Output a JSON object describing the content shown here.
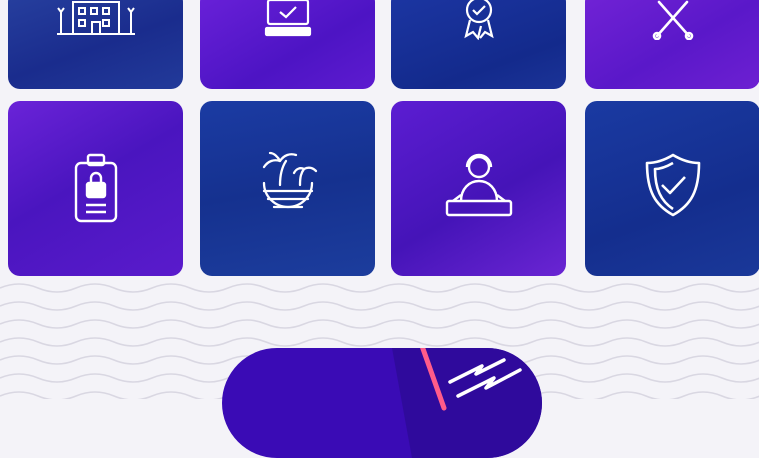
{
  "tiles": [
    {
      "id": "hotel",
      "icon": "hotel-building-icon",
      "tint": "#1b2f9a"
    },
    {
      "id": "checkin",
      "icon": "laptop-check-icon",
      "tint": "#5a1ad6"
    },
    {
      "id": "award",
      "icon": "award-badge-icon",
      "tint": "#18309a"
    },
    {
      "id": "dining",
      "icon": "crossed-utensils-icon",
      "tint": "#6a1fd0"
    },
    {
      "id": "credential",
      "icon": "id-badge-lock-icon",
      "tint": "#5516c9"
    },
    {
      "id": "beach",
      "icon": "beach-palm-island-icon",
      "tint": "#163c9e"
    },
    {
      "id": "entertainment",
      "icon": "dj-performer-icon",
      "tint": "#5218c2"
    },
    {
      "id": "security",
      "icon": "shield-check-icon",
      "tint": "#17359c"
    }
  ],
  "colors": {
    "background": "#f4f3f8",
    "wave": "#d9d7e2",
    "cta": "#3a0bb5",
    "cta_stripe": "#ff5c8a"
  }
}
